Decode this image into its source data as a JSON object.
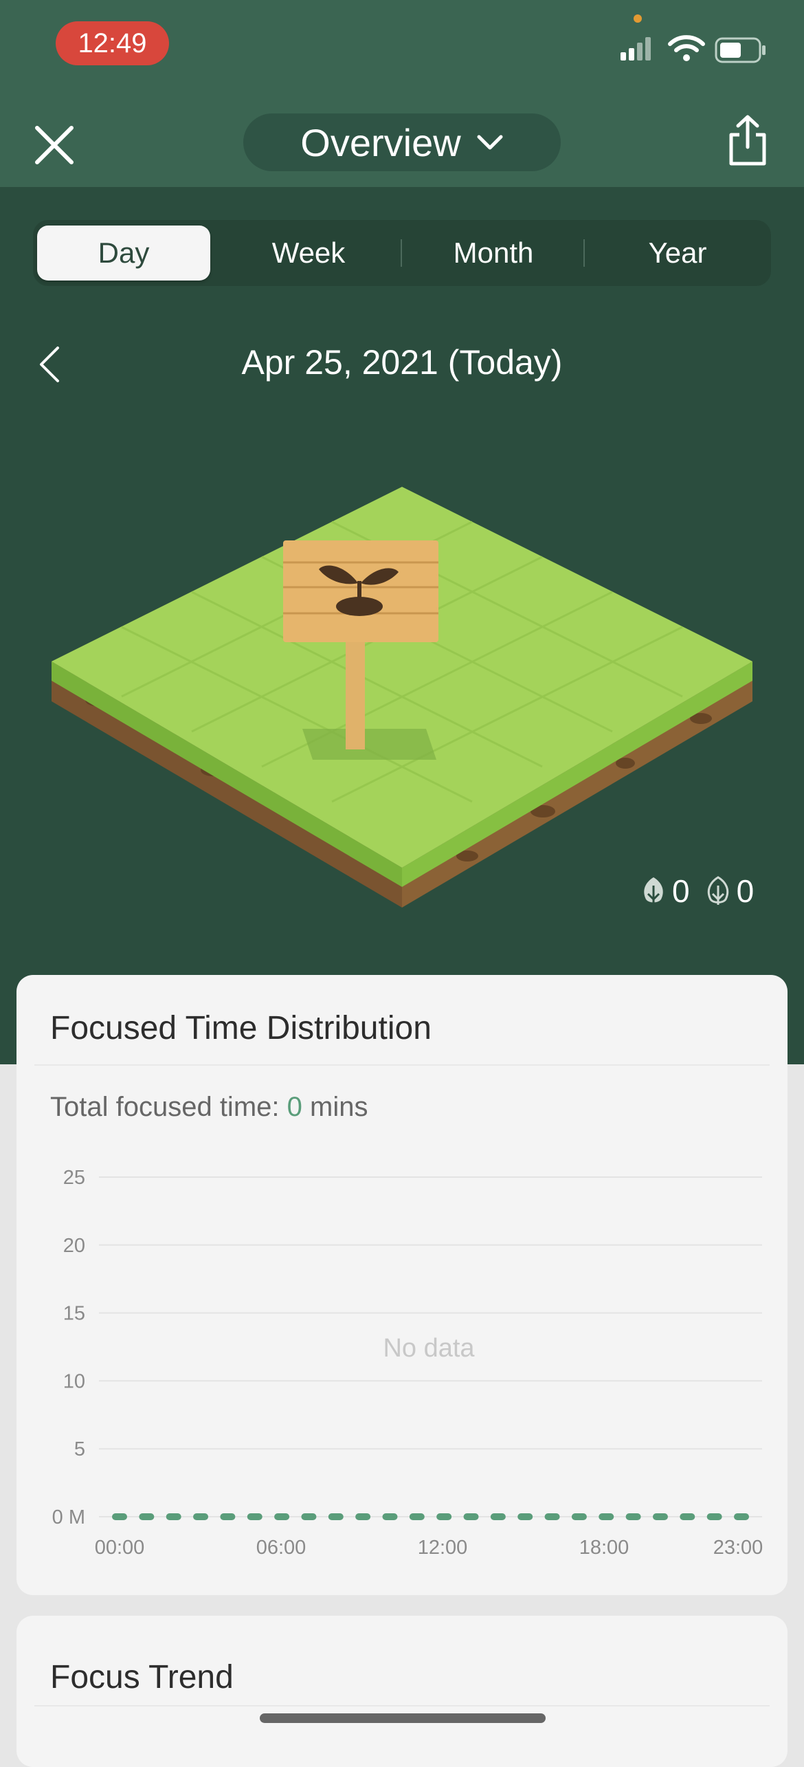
{
  "status_bar": {
    "time": "12:49",
    "icons": [
      "signal-icon",
      "wifi-icon",
      "battery-icon"
    ]
  },
  "header": {
    "title": "Overview",
    "icons": [
      "close-icon",
      "chevron-down-icon",
      "share-icon"
    ]
  },
  "tabs": [
    {
      "label": "Day",
      "active": true
    },
    {
      "label": "Week",
      "active": false
    },
    {
      "label": "Month",
      "active": false
    },
    {
      "label": "Year",
      "active": false
    }
  ],
  "date": {
    "label": "Apr 25, 2021 (Today)"
  },
  "counts": {
    "healthy_trees": "0",
    "withered_trees": "0"
  },
  "distribution_card": {
    "title": "Focused Time Distribution",
    "total_label": "Total focused time:",
    "total_value": "0",
    "total_unit": "mins"
  },
  "chart_data": {
    "type": "bar",
    "ylim": [
      0,
      25
    ],
    "y_ticks": [
      "0 M",
      "5",
      "10",
      "15",
      "20",
      "25"
    ],
    "x_tick_labels": [
      "00:00",
      "06:00",
      "12:00",
      "18:00",
      "23:00"
    ],
    "categories": [
      "00",
      "01",
      "02",
      "03",
      "04",
      "05",
      "06",
      "07",
      "08",
      "09",
      "10",
      "11",
      "12",
      "13",
      "14",
      "15",
      "16",
      "17",
      "18",
      "19",
      "20",
      "21",
      "22",
      "23"
    ],
    "values": [
      0,
      0,
      0,
      0,
      0,
      0,
      0,
      0,
      0,
      0,
      0,
      0,
      0,
      0,
      0,
      0,
      0,
      0,
      0,
      0,
      0,
      0,
      0,
      0
    ],
    "empty_message": "No data",
    "grid": true,
    "bar_color": "#5a9d7a"
  },
  "trend_card": {
    "title": "Focus Trend"
  },
  "colors": {
    "header": "#3b6552",
    "background": "#2b4d3e",
    "accent": "#5a9d7a",
    "time_pill": "#d8473c"
  }
}
